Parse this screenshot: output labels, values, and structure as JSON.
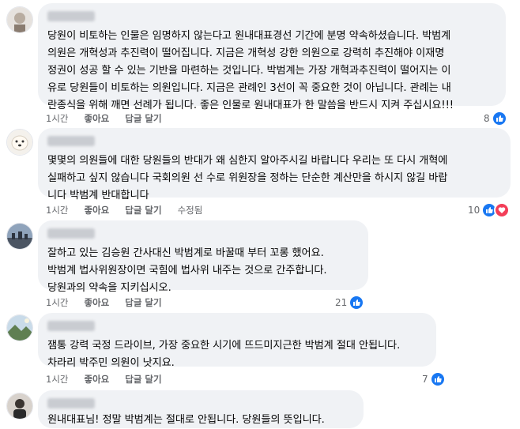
{
  "comments": [
    {
      "text": "당원이 비토하는 인물은 임명하지 않는다고 원내대표경선 기간에 분명 약속하셨습니다. 박범계\n의원은 개혁성과 추진력이 떨어집니다. 지금은 개혁성 강한 의원으로 강력히 추진해야 이재명\n정권이 성공 할 수 있는 기반을 마련하는 것입니다. 박범계는 가장 개혁과추진력이 떨어지는 이\n유로 당원들이 비토하는 의원입니다. 지금은 관례인 3선이 꼭 중요한 것이 아닙니다. 관례는 내\n란종식을 위해 깨면 선례가 됩니다. 좋은 인물로 원내대표가 한 말씀을 반드시 지켜 주십시요!!!",
      "time": "1시간",
      "like": "좋아요",
      "reply": "답글 달기",
      "edited": "",
      "reaction_count": "8",
      "reactions": [
        "like"
      ]
    },
    {
      "text": "몇몇의 의원들에 대한 당원들의 반대가 왜 심한지 알아주시길 바랍니다 우리는 또 다시 개혁에\n실패하고 싶지 않습니다 국회의원 선 수로 위원장을 정하는 단순한 계산만을 하시지 않길 바랍\n니다 박범계 반대합니다",
      "time": "1시간",
      "like": "좋아요",
      "reply": "답글 달기",
      "edited": "수정됨",
      "reaction_count": "10",
      "reactions": [
        "like",
        "love"
      ]
    },
    {
      "text": "잘하고 있는 김승원 간사대신 박범계로 바꿀때 부터 꼬롱 했어요.\n박범계 법사위원장이면 국힘에 법사위 내주는 것으로 간주합니다.\n당원과의 약속을 지키십시오.",
      "time": "1시간",
      "like": "좋아요",
      "reply": "답글 달기",
      "edited": "",
      "reaction_count": "21",
      "reactions": [
        "like"
      ]
    },
    {
      "text": "잼통 강력 국정 드라이브, 가장 중요한 시기에 뜨드미지근한 박범계 절대 안됩니다.\n차라리 박주민 의원이 낫지요.",
      "time": "1시간",
      "like": "좋아요",
      "reply": "답글 달기",
      "edited": "",
      "reaction_count": "7",
      "reactions": [
        "like"
      ]
    },
    {
      "text": "원내대표님! 정말 박범계는 절대로 안됩니다. 당원들의 뜻입니다.",
      "time": "",
      "like": "",
      "reply": "",
      "edited": "",
      "reaction_count": "",
      "reactions": []
    }
  ],
  "colors": {
    "bubble": "#f0f2f5",
    "like": "#1877f2",
    "love": "#f33e58",
    "meta": "#65676b"
  },
  "icons": {
    "like": "thumbs-up-icon",
    "love": "heart-icon"
  }
}
